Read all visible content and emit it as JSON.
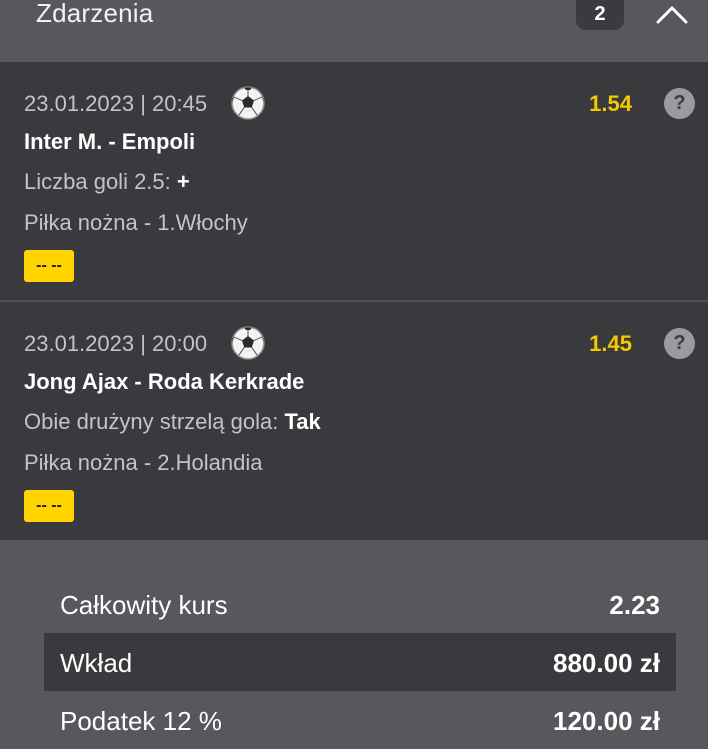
{
  "header": {
    "title": "Zdarzenia",
    "count": "2",
    "collapse_icon": "chevron-up-icon"
  },
  "events": [
    {
      "datetime": "23.01.2023 | 20:45",
      "sport_icon": "soccer-ball-icon",
      "odds": "1.54",
      "help": "?",
      "teams": "Inter M. - Empoli",
      "market_label": "Liczba goli 2.5:",
      "market_pick": "+",
      "league": "Piłka nożna - 1.Włochy",
      "result": "-- --"
    },
    {
      "datetime": "23.01.2023 | 20:00",
      "sport_icon": "soccer-ball-icon",
      "odds": "1.45",
      "help": "?",
      "teams": "Jong Ajax - Roda Kerkrade",
      "market_label": "Obie drużyny strzelą gola:",
      "market_pick": "Tak",
      "league": "Piłka nożna - 2.Holandia",
      "result": "-- --"
    }
  ],
  "summary": {
    "total_odds_label": "Całkowity kurs",
    "total_odds_value": "2.23",
    "stake_label": "Wkład",
    "stake_value": "880.00 zł",
    "tax_label": "Podatek 12 %",
    "tax_value": "120.00 zł"
  },
  "colors": {
    "accent": "#f5c800",
    "badge": "#ffd400",
    "panel": "#3a3a3e",
    "background": "#58585c"
  }
}
